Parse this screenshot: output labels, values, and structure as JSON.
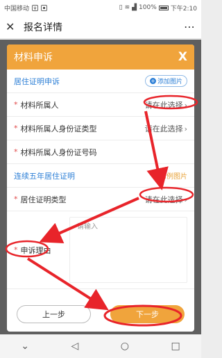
{
  "status_bar": {
    "carrier": "中国移动",
    "battery_percent": "100%",
    "time": "下午2:10"
  },
  "titlebar": {
    "close_icon": "close-icon",
    "title": "报名详情",
    "more_icon": "more-dots-icon"
  },
  "modal": {
    "title": "材料申诉",
    "close_label": "X",
    "section1": {
      "title": "居住证明申诉",
      "add_button": "添加图片"
    },
    "fields": [
      {
        "label": "材料所属人",
        "placeholder": "请在此选择"
      },
      {
        "label": "材料所属人身份证类型",
        "placeholder": "请在此选择"
      },
      {
        "label": "材料所属人身份证号码"
      }
    ],
    "section2": {
      "title": "连续五年居住证明",
      "example_label": "示例图片"
    },
    "residence_type": {
      "label": "居住证明类型",
      "placeholder": "请在此选择"
    },
    "reason": {
      "label": "申诉理由",
      "placeholder": "请输入"
    },
    "buttons": {
      "prev": "上一步",
      "next": "下一步"
    }
  },
  "colors": {
    "accent_orange": "#f0a43c",
    "link_blue": "#2d7fd6",
    "required_red": "#e14b4b",
    "annotation_red": "#e8242a"
  }
}
